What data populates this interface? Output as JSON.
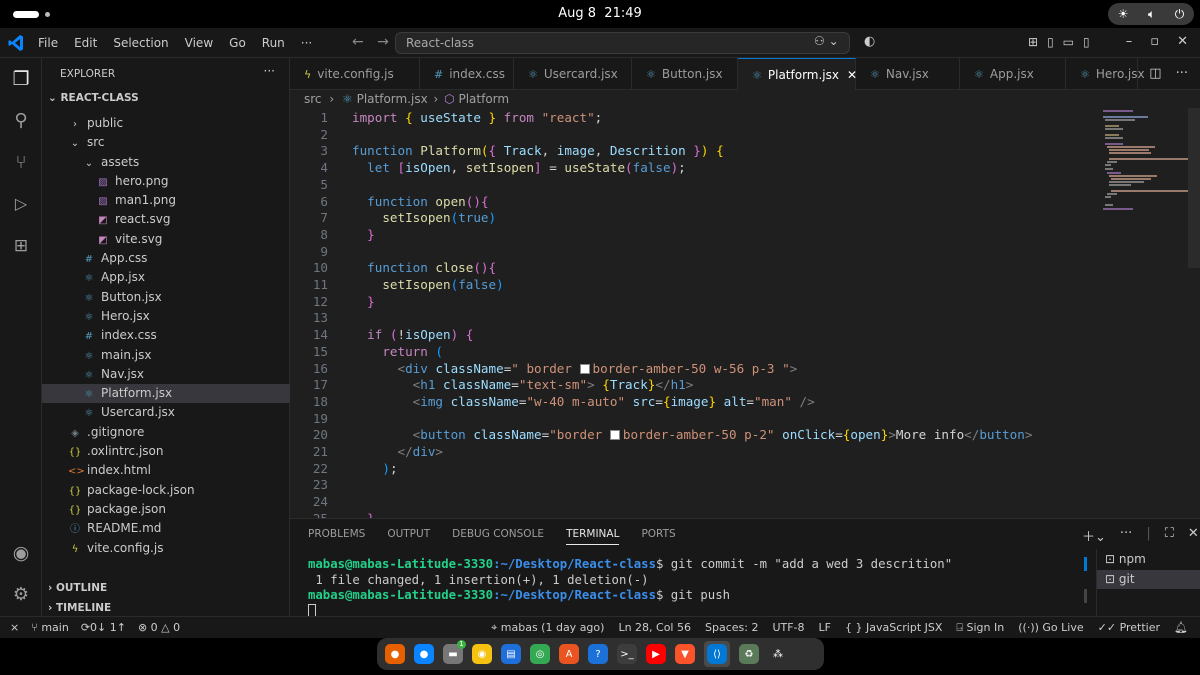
{
  "system": {
    "date": "Aug 8",
    "time": "21:49"
  },
  "titlebar": {
    "menus": [
      "File",
      "Edit",
      "Selection",
      "View",
      "Go",
      "Run"
    ],
    "more": "···",
    "search": "React-class"
  },
  "sidebar": {
    "title": "EXPLORER",
    "project": "REACT-CLASS",
    "items": [
      {
        "label": "public",
        "icon": "›",
        "indent": 1,
        "color": "#ccc"
      },
      {
        "label": "src",
        "icon": "⌄",
        "indent": 1,
        "color": "#ccc"
      },
      {
        "label": "assets",
        "icon": "⌄",
        "indent": 2,
        "color": "#ccc"
      },
      {
        "label": "hero.png",
        "icon": "▨",
        "indent": 3,
        "color": "#a074c4"
      },
      {
        "label": "man1.png",
        "icon": "▨",
        "indent": 3,
        "color": "#a074c4"
      },
      {
        "label": "react.svg",
        "icon": "◩",
        "indent": 3,
        "color": "#c586c0"
      },
      {
        "label": "vite.svg",
        "icon": "◩",
        "indent": 3,
        "color": "#c586c0"
      },
      {
        "label": "App.css",
        "icon": "#",
        "indent": 2,
        "color": "#519aba"
      },
      {
        "label": "App.jsx",
        "icon": "⚛",
        "indent": 2,
        "color": "#519aba"
      },
      {
        "label": "Button.jsx",
        "icon": "⚛",
        "indent": 2,
        "color": "#519aba"
      },
      {
        "label": "Hero.jsx",
        "icon": "⚛",
        "indent": 2,
        "color": "#519aba"
      },
      {
        "label": "index.css",
        "icon": "#",
        "indent": 2,
        "color": "#519aba"
      },
      {
        "label": "main.jsx",
        "icon": "⚛",
        "indent": 2,
        "color": "#519aba"
      },
      {
        "label": "Nav.jsx",
        "icon": "⚛",
        "indent": 2,
        "color": "#519aba"
      },
      {
        "label": "Platform.jsx",
        "icon": "⚛",
        "indent": 2,
        "color": "#519aba",
        "active": true
      },
      {
        "label": "Usercard.jsx",
        "icon": "⚛",
        "indent": 2,
        "color": "#519aba"
      },
      {
        "label": ".gitignore",
        "icon": "◈",
        "indent": 1,
        "color": "#6d8086"
      },
      {
        "label": ".oxlintrc.json",
        "icon": "{}",
        "indent": 1,
        "color": "#cbcb41"
      },
      {
        "label": "index.html",
        "icon": "<>",
        "indent": 1,
        "color": "#e37933"
      },
      {
        "label": "package-lock.json",
        "icon": "{}",
        "indent": 1,
        "color": "#cbcb41"
      },
      {
        "label": "package.json",
        "icon": "{}",
        "indent": 1,
        "color": "#cbcb41"
      },
      {
        "label": "README.md",
        "icon": "ⓘ",
        "indent": 1,
        "color": "#519aba"
      },
      {
        "label": "vite.config.js",
        "icon": "ϟ",
        "indent": 1,
        "color": "#cbcb41"
      }
    ],
    "outline": "OUTLINE",
    "timeline": "TIMELINE"
  },
  "tabs": [
    {
      "label": "vite.config.js",
      "icon": "ϟ",
      "color": "#cbcb41"
    },
    {
      "label": "index.css",
      "icon": "#",
      "color": "#519aba"
    },
    {
      "label": "Usercard.jsx",
      "icon": "⚛",
      "color": "#519aba"
    },
    {
      "label": "Button.jsx",
      "icon": "⚛",
      "color": "#519aba"
    },
    {
      "label": "Platform.jsx",
      "icon": "⚛",
      "color": "#519aba",
      "active": true,
      "close": "✕"
    },
    {
      "label": "Nav.jsx",
      "icon": "⚛",
      "color": "#519aba"
    },
    {
      "label": "App.jsx",
      "icon": "⚛",
      "color": "#519aba"
    },
    {
      "label": "Hero.jsx",
      "icon": "⚛",
      "color": "#519aba"
    }
  ],
  "breadcrumb": {
    "folder": "src",
    "file": "Platform.jsx",
    "symbol": "Platform"
  },
  "code": [
    {
      "n": "1",
      "c": [
        [
          "k",
          "import "
        ],
        [
          "p",
          "{ "
        ],
        [
          "v",
          "useState"
        ],
        [
          "p",
          " }"
        ],
        [
          "k",
          " from "
        ],
        [
          "s",
          "\"react\""
        ],
        [
          "w",
          ";"
        ]
      ]
    },
    {
      "n": "2",
      "c": []
    },
    {
      "n": "3",
      "c": [
        [
          "t",
          "function "
        ],
        [
          "f",
          "Platform"
        ],
        [
          "p",
          "("
        ],
        [
          "pk",
          "{ "
        ],
        [
          "v",
          "Track"
        ],
        [
          "w",
          ", "
        ],
        [
          "v",
          "image"
        ],
        [
          "w",
          ", "
        ],
        [
          "v",
          "Descrition "
        ],
        [
          "pk",
          "}"
        ],
        [
          "p",
          ")"
        ],
        [
          "w",
          " "
        ],
        [
          "p",
          "{"
        ]
      ]
    },
    {
      "n": "4",
      "c": [
        [
          "w",
          "  "
        ],
        [
          "t",
          "let "
        ],
        [
          "pk",
          "["
        ],
        [
          "v",
          "isOpen"
        ],
        [
          "w",
          ", "
        ],
        [
          "f",
          "setIsopen"
        ],
        [
          "pk",
          "]"
        ],
        [
          "w",
          " = "
        ],
        [
          "f",
          "useState"
        ],
        [
          "pk",
          "("
        ],
        [
          "b",
          "false"
        ],
        [
          "pk",
          ")"
        ],
        [
          "w",
          ";"
        ]
      ]
    },
    {
      "n": "5",
      "c": []
    },
    {
      "n": "6",
      "c": [
        [
          "w",
          "  "
        ],
        [
          "t",
          "function "
        ],
        [
          "f",
          "open"
        ],
        [
          "pk",
          "()"
        ],
        [
          "pk",
          "{"
        ]
      ]
    },
    {
      "n": "7",
      "c": [
        [
          "w",
          "    "
        ],
        [
          "f",
          "setIsopen"
        ],
        [
          "bl",
          "("
        ],
        [
          "b",
          "true"
        ],
        [
          "bl",
          ")"
        ]
      ]
    },
    {
      "n": "8",
      "c": [
        [
          "w",
          "  "
        ],
        [
          "pk",
          "}"
        ]
      ]
    },
    {
      "n": "9",
      "c": []
    },
    {
      "n": "10",
      "c": [
        [
          "w",
          "  "
        ],
        [
          "t",
          "function "
        ],
        [
          "f",
          "close"
        ],
        [
          "pk",
          "()"
        ],
        [
          "pk",
          "{"
        ]
      ]
    },
    {
      "n": "11",
      "c": [
        [
          "w",
          "    "
        ],
        [
          "f",
          "setIsopen"
        ],
        [
          "bl",
          "("
        ],
        [
          "b",
          "false"
        ],
        [
          "bl",
          ")"
        ]
      ]
    },
    {
      "n": "12",
      "c": [
        [
          "w",
          "  "
        ],
        [
          "pk",
          "}"
        ]
      ]
    },
    {
      "n": "13",
      "c": []
    },
    {
      "n": "14",
      "c": [
        [
          "w",
          "  "
        ],
        [
          "k",
          "if "
        ],
        [
          "pk",
          "("
        ],
        [
          "w",
          "!"
        ],
        [
          "v",
          "isOpen"
        ],
        [
          "pk",
          ")"
        ],
        [
          "w",
          " "
        ],
        [
          "pk",
          "{"
        ]
      ]
    },
    {
      "n": "15",
      "c": [
        [
          "w",
          "    "
        ],
        [
          "k",
          "return "
        ],
        [
          "bl",
          "("
        ]
      ]
    },
    {
      "n": "16",
      "c": [
        [
          "w",
          "      "
        ],
        [
          "g",
          "<"
        ],
        [
          "b",
          "div "
        ],
        [
          "v",
          "className"
        ],
        [
          "w",
          "="
        ],
        [
          "s",
          "\" border "
        ],
        [
          "sw",
          ""
        ],
        [
          "s",
          "border-amber-50 w-56 p-3 \""
        ],
        [
          "g",
          ">"
        ]
      ]
    },
    {
      "n": "17",
      "c": [
        [
          "w",
          "        "
        ],
        [
          "g",
          "<"
        ],
        [
          "b",
          "h1 "
        ],
        [
          "v",
          "className"
        ],
        [
          "w",
          "="
        ],
        [
          "s",
          "\"text-sm\""
        ],
        [
          "g",
          "> "
        ],
        [
          "p",
          "{"
        ],
        [
          "v",
          "Track"
        ],
        [
          "p",
          "}"
        ],
        [
          "g",
          "</"
        ],
        [
          "b",
          "h1"
        ],
        [
          "g",
          ">"
        ]
      ]
    },
    {
      "n": "18",
      "c": [
        [
          "w",
          "        "
        ],
        [
          "g",
          "<"
        ],
        [
          "b",
          "img "
        ],
        [
          "v",
          "className"
        ],
        [
          "w",
          "="
        ],
        [
          "s",
          "\"w-40 m-auto\""
        ],
        [
          "w",
          " "
        ],
        [
          "v",
          "src"
        ],
        [
          "w",
          "="
        ],
        [
          "p",
          "{"
        ],
        [
          "v",
          "image"
        ],
        [
          "p",
          "}"
        ],
        [
          "w",
          " "
        ],
        [
          "v",
          "alt"
        ],
        [
          "w",
          "="
        ],
        [
          "s",
          "\"man\""
        ],
        [
          "w",
          " "
        ],
        [
          "g",
          "/>"
        ]
      ]
    },
    {
      "n": "19",
      "c": []
    },
    {
      "n": "20",
      "c": [
        [
          "w",
          "        "
        ],
        [
          "g",
          "<"
        ],
        [
          "b",
          "button "
        ],
        [
          "v",
          "className"
        ],
        [
          "w",
          "="
        ],
        [
          "s",
          "\"border "
        ],
        [
          "sw",
          ""
        ],
        [
          "s",
          "border-amber-50 p-2\""
        ],
        [
          "w",
          " "
        ],
        [
          "v",
          "onClick"
        ],
        [
          "w",
          "="
        ],
        [
          "p",
          "{"
        ],
        [
          "v",
          "open"
        ],
        [
          "p",
          "}"
        ],
        [
          "g",
          ">"
        ],
        [
          "w",
          "More info"
        ],
        [
          "g",
          "</"
        ],
        [
          "b",
          "button"
        ],
        [
          "g",
          ">"
        ]
      ]
    },
    {
      "n": "21",
      "c": [
        [
          "w",
          "      "
        ],
        [
          "g",
          "</"
        ],
        [
          "b",
          "div"
        ],
        [
          "g",
          ">"
        ]
      ]
    },
    {
      "n": "22",
      "c": [
        [
          "w",
          "    "
        ],
        [
          "bl",
          ")"
        ],
        [
          "w",
          ";"
        ]
      ]
    },
    {
      "n": "23",
      "c": []
    },
    {
      "n": "24",
      "c": []
    },
    {
      "n": "25",
      "c": [
        [
          "w",
          "  "
        ],
        [
          "pk",
          "}"
        ]
      ]
    }
  ],
  "panel": {
    "tabs": [
      "PROBLEMS",
      "OUTPUT",
      "DEBUG CONSOLE",
      "TERMINAL",
      "PORTS"
    ],
    "active_tab": "TERMINAL",
    "terminal": [
      {
        "user": "mabas@mabas-Latitude-3330",
        "path": ":~/Desktop/React-class",
        "cmd": "$ git commit -m \"add a wed 3 descrition\""
      },
      {
        "text": " 1 file changed, 1 insertion(+), 1 deletion(-)"
      },
      {
        "user": "mabas@mabas-Latitude-3330",
        "path": ":~/Desktop/React-class",
        "cmd": "$ git push"
      }
    ],
    "sessions": [
      "npm",
      "git"
    ]
  },
  "status": {
    "remote": "⨯",
    "branch": "main",
    "sync": "0↓ 1↑",
    "problems": "⊗ 0 △ 0",
    "blame": "mabas (1 day ago)",
    "position": "Ln 28, Col 56",
    "spaces": "Spaces: 2",
    "encoding": "UTF-8",
    "eol": "LF",
    "language": "JavaScript JSX",
    "signin": "Sign In",
    "golive": "Go Live",
    "prettier": "Prettier"
  },
  "dock": [
    {
      "name": "firefox",
      "bg": "#e66000",
      "glyph": "●"
    },
    {
      "name": "thunderbird",
      "bg": "#0a84ff",
      "glyph": "●"
    },
    {
      "name": "files",
      "bg": "#777",
      "glyph": "▬",
      "badge": "1"
    },
    {
      "name": "rhythmbox",
      "bg": "#f5c211",
      "glyph": "◉"
    },
    {
      "name": "libreoffice-writer",
      "bg": "#1e6fd9",
      "glyph": "▤"
    },
    {
      "name": "chrome",
      "bg": "#34a853",
      "glyph": "◎"
    },
    {
      "name": "software-center",
      "bg": "#e95420",
      "glyph": "A"
    },
    {
      "name": "help",
      "bg": "#1c71d8",
      "glyph": "?"
    },
    {
      "name": "terminal",
      "bg": "#3d3d3d",
      "glyph": ">_"
    },
    {
      "name": "youtube",
      "bg": "#ff0000",
      "glyph": "▶"
    },
    {
      "name": "brave",
      "bg": "#fb542b",
      "glyph": "▼"
    },
    {
      "name": "vscode",
      "bg": "#0078d4",
      "glyph": "⟨⟩",
      "active": true
    },
    {
      "name": "trash",
      "bg": "#5a7a5a",
      "glyph": "♻"
    },
    {
      "name": "show-apps",
      "bg": "#2f2f2f",
      "glyph": "⁂"
    }
  ]
}
